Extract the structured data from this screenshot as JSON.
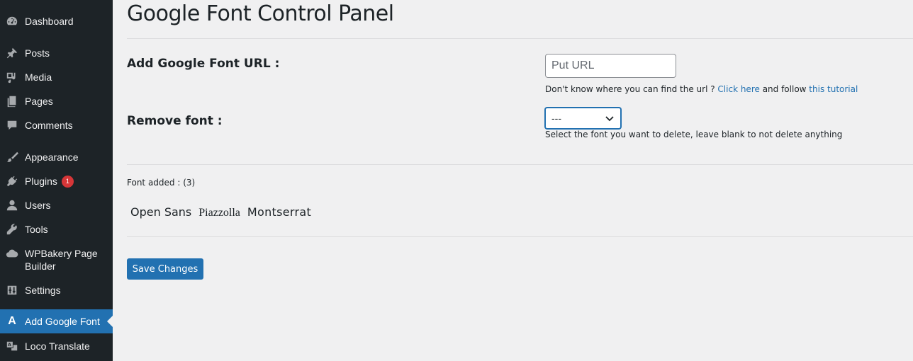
{
  "sidebar": {
    "items": [
      {
        "label": "Dashboard",
        "icon": "dashboard-icon"
      },
      {
        "label": "Posts",
        "icon": "pushpin-icon"
      },
      {
        "label": "Media",
        "icon": "media-icon"
      },
      {
        "label": "Pages",
        "icon": "pages-icon"
      },
      {
        "label": "Comments",
        "icon": "comment-icon"
      },
      {
        "label": "Appearance",
        "icon": "paintbrush-icon"
      },
      {
        "label": "Plugins",
        "icon": "plugin-icon",
        "badge": "1"
      },
      {
        "label": "Users",
        "icon": "user-icon"
      },
      {
        "label": "Tools",
        "icon": "wrench-icon"
      },
      {
        "label": "WPBakery Page",
        "label2": "Builder",
        "icon": "cloud-icon"
      },
      {
        "label": "Settings",
        "icon": "settings-sliders-icon"
      },
      {
        "label": "Add Google Font",
        "icon": "letter-a-icon",
        "icon_glyph": "A",
        "current": true
      },
      {
        "label": "Loco Translate",
        "icon": "translate-icon"
      }
    ]
  },
  "main": {
    "title": "Google Font Control Panel",
    "add_url": {
      "label": "Add Google Font URL :",
      "placeholder": "Put URL",
      "help_prefix": "Don't know where you can find the url ? ",
      "help_link1": "Click here",
      "help_middle": " and follow ",
      "help_link2": "this tutorial"
    },
    "remove_font": {
      "label": "Remove font :",
      "selected": "---",
      "help": "Select the font you want to delete, leave blank to not delete anything"
    },
    "fonts_added_label": "Font added : (3)",
    "fonts": [
      "Open Sans",
      "Piazzolla",
      "Montserrat"
    ],
    "save_label": "Save Changes"
  },
  "colors": {
    "sidebar_bg": "#1d2327",
    "accent": "#2271b1",
    "badge": "#d63638",
    "page_bg": "#f0f0f1"
  }
}
